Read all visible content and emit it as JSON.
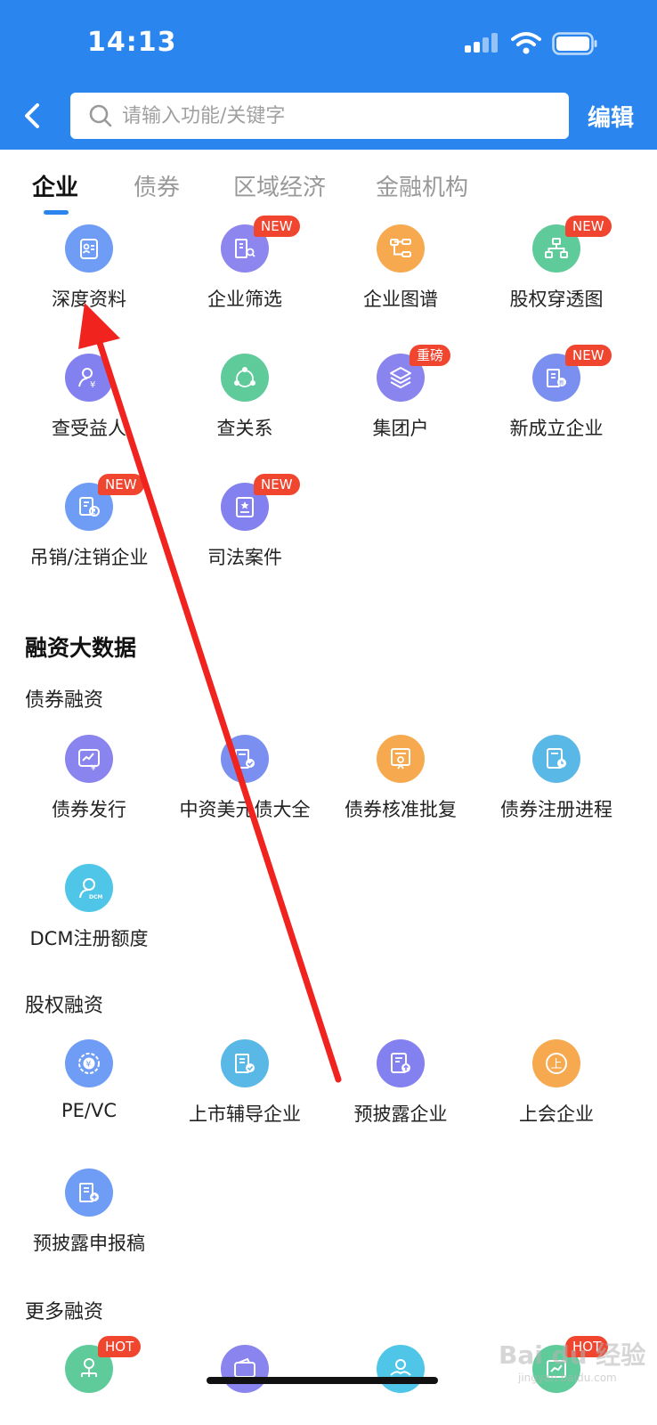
{
  "status_bar": {
    "time": "14:13"
  },
  "header": {
    "search_placeholder": "请输入功能/关键字",
    "edit_label": "编辑"
  },
  "tabs": [
    {
      "label": "企业",
      "active": true
    },
    {
      "label": "债券",
      "active": false
    },
    {
      "label": "区域经济",
      "active": false
    },
    {
      "label": "金融机构",
      "active": false
    }
  ],
  "enterprise_items": [
    {
      "label": "深度资料",
      "badge": "",
      "icon": "profile-card-icon",
      "color": "#6f9cf4"
    },
    {
      "label": "企业筛选",
      "badge": "NEW",
      "icon": "building-search-icon",
      "color": "#8d86ee"
    },
    {
      "label": "企业图谱",
      "badge": "",
      "icon": "graph-tree-icon",
      "color": "#f7a94f"
    },
    {
      "label": "股权穿透图",
      "badge": "NEW",
      "icon": "org-chart-icon",
      "color": "#5fcb9a"
    },
    {
      "label": "查受益人",
      "badge": "",
      "icon": "person-yen-icon",
      "color": "#8380ef"
    },
    {
      "label": "查关系",
      "badge": "",
      "icon": "relation-icon",
      "color": "#5fcb9a"
    },
    {
      "label": "集团户",
      "badge": "重磅",
      "icon": "layers-icon",
      "color": "#8a84ee"
    },
    {
      "label": "新成立企业",
      "badge": "NEW",
      "icon": "new-building-icon",
      "color": "#7b8ff0"
    },
    {
      "label": "吊销/注销企业",
      "badge": "NEW",
      "icon": "revoked-doc-icon",
      "color": "#6f9cf4"
    },
    {
      "label": "司法案件",
      "badge": "NEW",
      "icon": "legal-case-icon",
      "color": "#8380ef"
    }
  ],
  "financing": {
    "title": "融资大数据",
    "bond": {
      "title": "债券融资",
      "items": [
        {
          "label": "债券发行",
          "badge": "",
          "icon": "trend-yen-icon",
          "color": "#8a84ee"
        },
        {
          "label": "中资美元债大全",
          "badge": "",
          "icon": "bond-check-icon",
          "color": "#7b8ff0"
        },
        {
          "label": "债券核准批复",
          "badge": "",
          "icon": "approval-doc-icon",
          "color": "#f7a94f"
        },
        {
          "label": "债券注册进程",
          "badge": "",
          "icon": "doc-clock-icon",
          "color": "#5ab8e6"
        },
        {
          "label": "DCM注册额度",
          "badge": "",
          "icon": "dcm-user-icon",
          "color": "#4fc6e8"
        }
      ]
    },
    "equity": {
      "title": "股权融资",
      "items": [
        {
          "label": "PE/VC",
          "badge": "",
          "icon": "coin-yen-icon",
          "color": "#6f9cf4"
        },
        {
          "label": "上市辅导企业",
          "badge": "",
          "icon": "listing-check-icon",
          "color": "#5ab8e6"
        },
        {
          "label": "预披露企业",
          "badge": "",
          "icon": "doc-upload-icon",
          "color": "#8380ef"
        },
        {
          "label": "上会企业",
          "badge": "",
          "icon": "circle-shang-icon",
          "color": "#f7a94f"
        },
        {
          "label": "预披露申报稿",
          "badge": "",
          "icon": "building-plus-icon",
          "color": "#6f9cf4"
        }
      ]
    },
    "more": {
      "title": "更多融资",
      "items": [
        {
          "label": "",
          "badge": "HOT",
          "icon": "money-tree-icon",
          "color": "#5fcb9a"
        },
        {
          "label": "",
          "badge": "",
          "icon": "wallet-icon",
          "color": "#8a84ee"
        },
        {
          "label": "",
          "badge": "",
          "icon": "hand-coin-icon",
          "color": "#4fc6e8"
        },
        {
          "label": "",
          "badge": "HOT",
          "icon": "chart-coin-icon",
          "color": "#5fcb9a"
        }
      ]
    }
  },
  "watermark": {
    "main": "Bai du 经验",
    "sub": "jingyan.baidu.com"
  }
}
